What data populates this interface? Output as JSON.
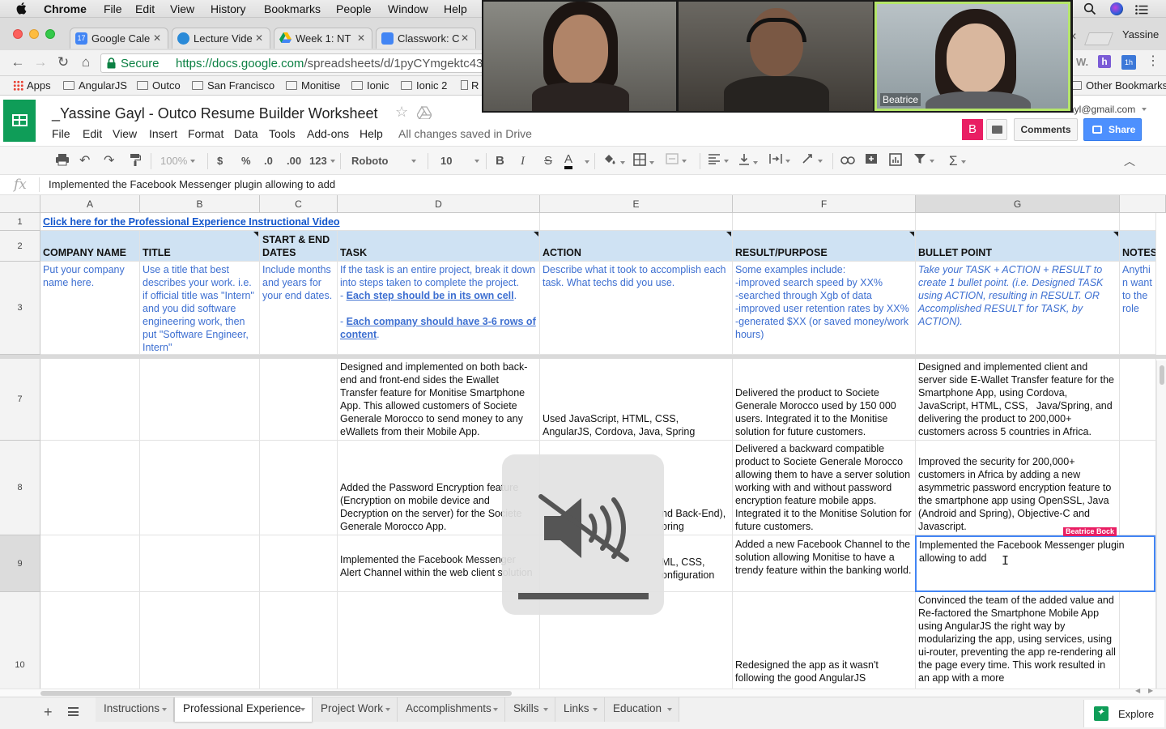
{
  "macos": {
    "app": "Chrome",
    "menu": [
      "File",
      "Edit",
      "View",
      "History",
      "Bookmarks",
      "People",
      "Window",
      "Help"
    ]
  },
  "browser": {
    "tabs": [
      {
        "title": "Google Cale",
        "icon": "calendar-icon",
        "color": "#4285f4"
      },
      {
        "title": "Lecture Vide",
        "icon": "globe-icon",
        "color": "#2a8ad8"
      },
      {
        "title": "Week 1: NT",
        "icon": "drive-icon",
        "color": "#0f9d58"
      },
      {
        "title": "Classwork: C",
        "icon": "classroom-icon",
        "color": "#4285f4"
      }
    ],
    "profile": "Yassine",
    "secure_label": "Secure",
    "url_host": "https://docs.google.com",
    "url_path": "/spreadsheets/d/1pyCYmgektc43jC",
    "bookmarks": [
      "Apps",
      "AngularJS",
      "Outco",
      "San Francisco",
      "Monitise",
      "Ionic",
      "Ionic 2",
      "R"
    ],
    "other_bookmarks": "Other Bookmarks"
  },
  "sheets": {
    "title": "_Yassine Gayl - Outco Resume Builder Worksheet",
    "menu": [
      "File",
      "Edit",
      "View",
      "Insert",
      "Format",
      "Data",
      "Tools",
      "Add-ons",
      "Help"
    ],
    "saved_status": "All changes saved in Drive",
    "account": "ayl@gmail.com",
    "collaborator_initial": "B",
    "comments_label": "Comments",
    "share_label": "Share",
    "toolbar": {
      "zoom": "100%",
      "currency": "$",
      "percent": "%",
      "dec_less": ".0",
      "dec_more": ".00",
      "number_format": "123",
      "font": "Roboto",
      "font_size": "10",
      "bold": "B",
      "italic": "I",
      "strike": "S",
      "text_color": "A"
    },
    "formula": {
      "label": "fx",
      "value": "Implemented the Facebook Messenger plugin allowing to add"
    },
    "columns": [
      "A",
      "B",
      "C",
      "D",
      "E",
      "F",
      "G"
    ],
    "rows": {
      "r1": {
        "num": "1",
        "link": "Click here for the Professional Experience Instructional Video"
      },
      "r2": {
        "num": "2",
        "headers": [
          "COMPANY NAME",
          "TITLE",
          "START & END DATES",
          "TASK",
          "ACTION",
          "RESULT/PURPOSE",
          "BULLET POINT",
          "NOTES"
        ]
      },
      "r3": {
        "num": "3",
        "a": "Put your company name here.",
        "b": "Use a title that best describes your work. i.e. if official title was \"Intern\" and you did software engineering work, then put \"Software Engineer, Intern\"",
        "c": "Include months and years for your end dates.",
        "d_intro": "If the task is an entire project, break it down into steps taken to complete the project.",
        "d_dash1": "- ",
        "d_link1": "Each step should be in its own cell",
        "d_dot": ".",
        "d_dash2": "- ",
        "d_link2": "Each company should have 3-6 rows of content",
        "d_end": ".",
        "e": "Describe what it took to accomplish each task. What techs did you use.",
        "f": "Some examples include:\n-improved search speed by XX%\n-searched through Xgb of data\n-improved user retention rates by XX%\n-generated $XX (or saved money/work hours)",
        "g": "Take your TASK + ACTION + RESULT to create 1 bullet point. (i.e. Designed TASK using ACTION, resulting in RESULT. OR Accomplished RESULT for TASK, by ACTION).",
        "h": "Anythin want to the role"
      },
      "r7": {
        "num": "7",
        "d": "Designed and implemented on both back-end and front-end sides the Ewallet Transfer feature for Monitise Smartphone App. This allowed customers of Societe Generale Morocco to send money to any eWallets from their Mobile App.",
        "e": "Used JavaScript, HTML, CSS, AngularJS, Cordova, Java, Spring",
        "f": "Delivered the product to Societe Generale Morocco used by 150 000 users. Integrated it to the Monitise solution for future customers.",
        "g": "Designed and implemented client and server side E-Wallet Transfer feature for the Smartphone App, using Cordova, JavaScript, HTML, CSS,   Java/Spring, and delivering the product to 200,000+ customers across 5 countries in Africa."
      },
      "r8": {
        "num": "8",
        "d": "Added the Password Encryption feature (Encryption on mobile device and Decryption on the server) for the Societe Generale Morocco App.",
        "e": "nd Back-End), oring",
        "f": "Delivered a backward compatible product to Societe Generale Morocco allowing them to have a server solution working with and without password encryption feature mobile apps. Integrated it to the Monitise Solution for future customers.",
        "g": "Improved the security for 200,000+ customers in Africa by adding a new asymmetric password encryption feature to the smartphone app using OpenSSL, Java (Android and Spring), Objective-C and Javascript."
      },
      "r9": {
        "num": "9",
        "d": "Implemented the Facebook Messenger Alert Channel within the web client solution",
        "e": "ML, CSS, onfiguration",
        "f": "Added a new Facebook Channel to the solution allowing Monitise to have a trendy feature within the banking world.",
        "g": "Implemented the Facebook Messenger plugin allowing to add"
      },
      "r10": {
        "num": "10",
        "f": "Redesigned the app as it wasn't following the good AngularJS",
        "g": "Convinced the team of the added value and Re-factored the Smartphone Mobile App using AngularJS the right way by modularizing the app, using services, using ui-router, preventing the app re-rendering all the page every time. This work resulted in an app with a more"
      }
    },
    "collaborator_cursor": "Beatrice Bock",
    "sheet_tabs": [
      "Instructions",
      "Professional Experience",
      "Project Work",
      "Accomplishments",
      "Skills",
      "Links",
      "Education"
    ],
    "active_tab": "Professional Experience",
    "explore_label": "Explore"
  },
  "video_call": {
    "active_speaker": "Beatrice",
    "accent": "#b5e66a"
  },
  "colors": {
    "header_fill": "#cfe2f3",
    "instruction_text": "#3d6fd1",
    "selection": "#4285f4",
    "collaborator": "#e91e63",
    "sheets_green": "#0f9d58"
  }
}
